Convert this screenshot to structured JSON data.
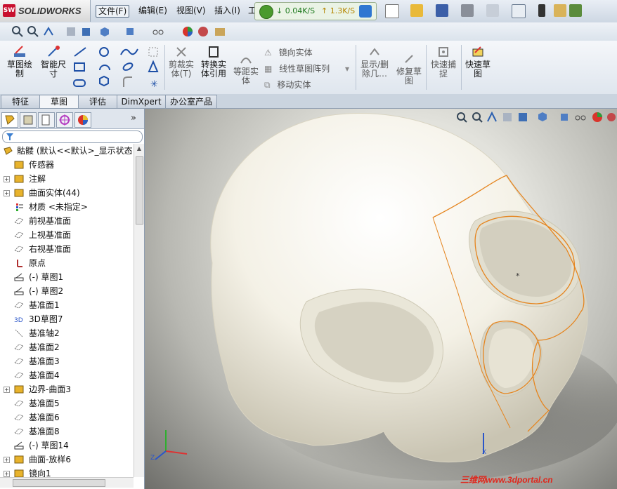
{
  "app": {
    "logo_badge": "SW",
    "logo_text": "SOLIDWORKS"
  },
  "menu": [
    {
      "label": "文件(F)"
    },
    {
      "label": "编辑(E)"
    },
    {
      "label": "视图(V)"
    },
    {
      "label": "插入(I)"
    },
    {
      "label": "工"
    }
  ],
  "net": {
    "down": "↓ 0.04K/S",
    "up": "↑ 1.3K/S"
  },
  "commands": {
    "sketch": "草图绘\n制",
    "smart_dim": "智能尺\n寸",
    "trim": "剪裁实\n体(T)",
    "convert": "转换实\n体引用",
    "offset": "等距实\n体",
    "mirror": "镜向实体",
    "linear_pattern": "线性草图阵列",
    "move": "移动实体",
    "show_delete": "显示/删\n除几…",
    "repair": "修复草\n图",
    "quick_snap": "快速捕\n捉",
    "rapid_sketch": "快速草\n图"
  },
  "tabs": [
    "特征",
    "草图",
    "评估",
    "DimXpert",
    "办公室产品"
  ],
  "active_tab": "草图",
  "tree": {
    "root": "骷髅 (默认<<默认>_显示状态",
    "items": [
      {
        "label": "传感器",
        "icon": "sensor-icon",
        "expand": false
      },
      {
        "label": "注解",
        "icon": "annotation-icon",
        "expand": true
      },
      {
        "label": "曲面实体(44)",
        "icon": "surface-body-icon",
        "expand": true
      },
      {
        "label": "材质 <未指定>",
        "icon": "material-icon",
        "expand": false
      },
      {
        "label": "前视基准面",
        "icon": "plane-icon",
        "expand": false
      },
      {
        "label": "上视基准面",
        "icon": "plane-icon",
        "expand": false
      },
      {
        "label": "右视基准面",
        "icon": "plane-icon",
        "expand": false
      },
      {
        "label": "原点",
        "icon": "origin-icon",
        "expand": false
      },
      {
        "label": "(-) 草图1",
        "icon": "sketch-icon",
        "expand": false
      },
      {
        "label": "(-) 草图2",
        "icon": "sketch-icon",
        "expand": false
      },
      {
        "label": "基准面1",
        "icon": "plane-icon",
        "expand": false
      },
      {
        "label": "3D草图7",
        "icon": "sketch3d-icon",
        "expand": false
      },
      {
        "label": "基准轴2",
        "icon": "axis-icon",
        "expand": false
      },
      {
        "label": "基准面2",
        "icon": "plane-icon",
        "expand": false
      },
      {
        "label": "基准面3",
        "icon": "plane-icon",
        "expand": false
      },
      {
        "label": "基准面4",
        "icon": "plane-icon",
        "expand": false
      },
      {
        "label": "边界-曲面3",
        "icon": "boundary-surface-icon",
        "expand": true
      },
      {
        "label": "基准面5",
        "icon": "plane-icon",
        "expand": false
      },
      {
        "label": "基准面6",
        "icon": "plane-icon",
        "expand": false
      },
      {
        "label": "基准面8",
        "icon": "plane-icon",
        "expand": false
      },
      {
        "label": "(-) 草图14",
        "icon": "sketch-icon",
        "expand": false
      },
      {
        "label": "曲面-放样6",
        "icon": "loft-surface-icon",
        "expand": true
      },
      {
        "label": "镜向1",
        "icon": "mirror-icon",
        "expand": true
      }
    ]
  },
  "watermark": "三维网www.3dportal.cn",
  "colors": {
    "accent": "#e0261b",
    "sketch_orange": "#e5851f",
    "model": "#f4f1e6"
  }
}
